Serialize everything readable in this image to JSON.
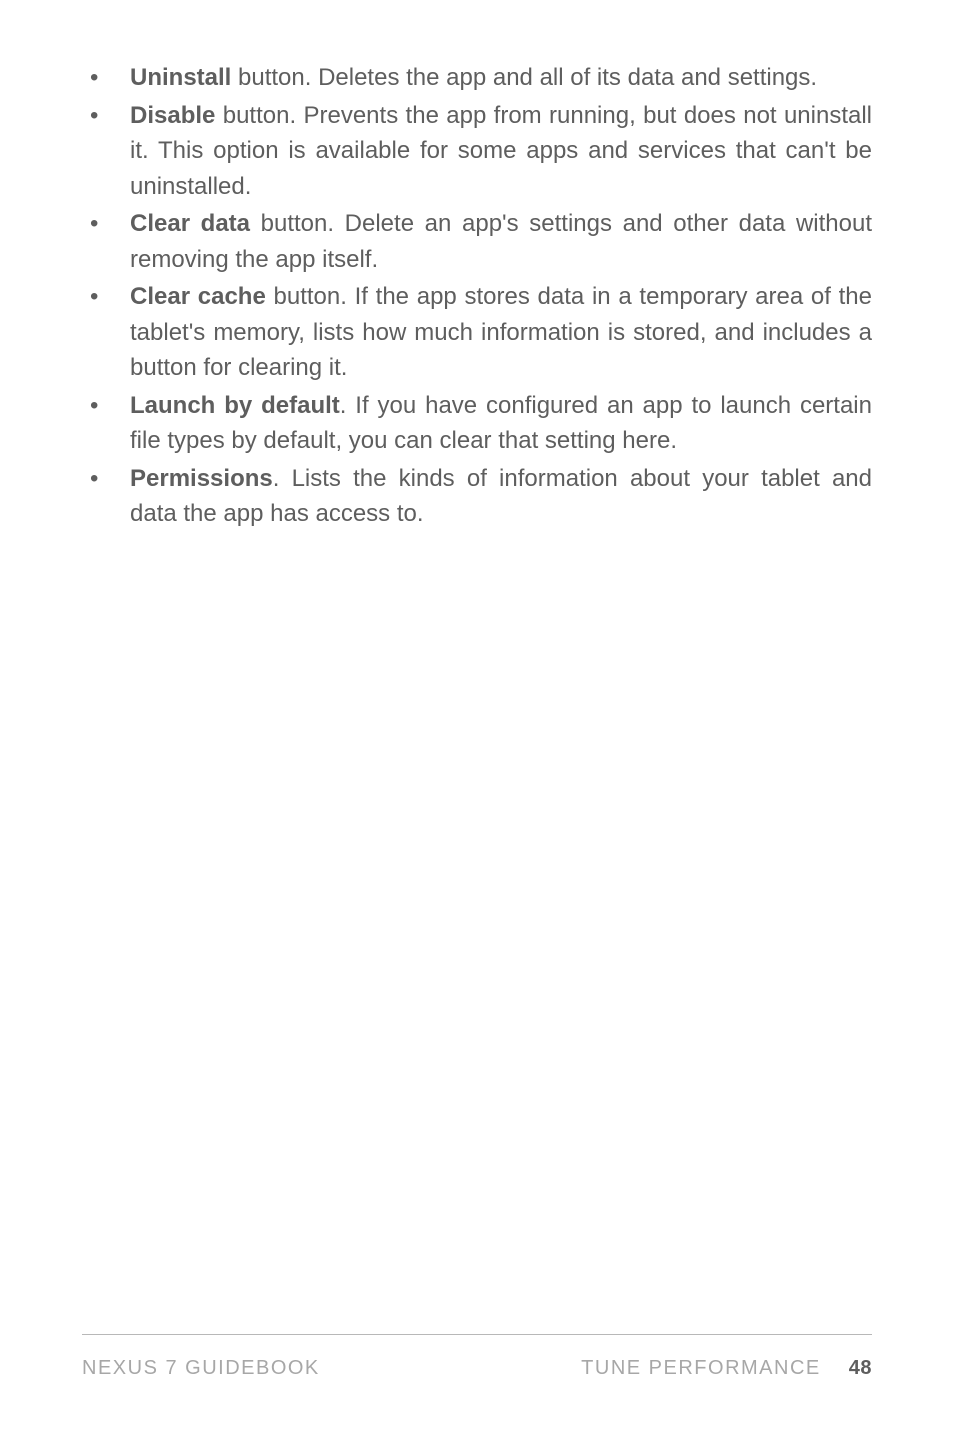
{
  "bullets": [
    {
      "bold": "Uninstall",
      "rest": " button. Deletes the app and all of its data and settings.",
      "justifyFirst": true
    },
    {
      "bold": "Disable",
      "rest": " button. Prevents the app from running, but does not uninstall it. This option is available for some apps and services that can't be uninstalled.",
      "justifyFirst": false
    },
    {
      "bold": "Clear data",
      "rest": " button. Delete an app's settings and other data without removing the app itself.",
      "justifyFirst": false
    },
    {
      "bold": "Clear cache",
      "rest": " button. If the app stores data in a temporary area of the tablet's memory, lists how much information is stored, and includes a button for clearing it.",
      "justifyFirst": false
    },
    {
      "bold": "Launch by default",
      "rest": ". If you have configured an app to launch certain file types by default, you can clear that setting here.",
      "justifyFirst": false
    },
    {
      "bold": "Permissions",
      "rest": ". Lists the kinds of information about your tablet and data the app has access to.",
      "justifyFirst": false
    }
  ],
  "footer": {
    "left": "NEXUS 7 GUIDEBOOK",
    "section": "TUNE PERFORMANCE",
    "page": "48"
  }
}
